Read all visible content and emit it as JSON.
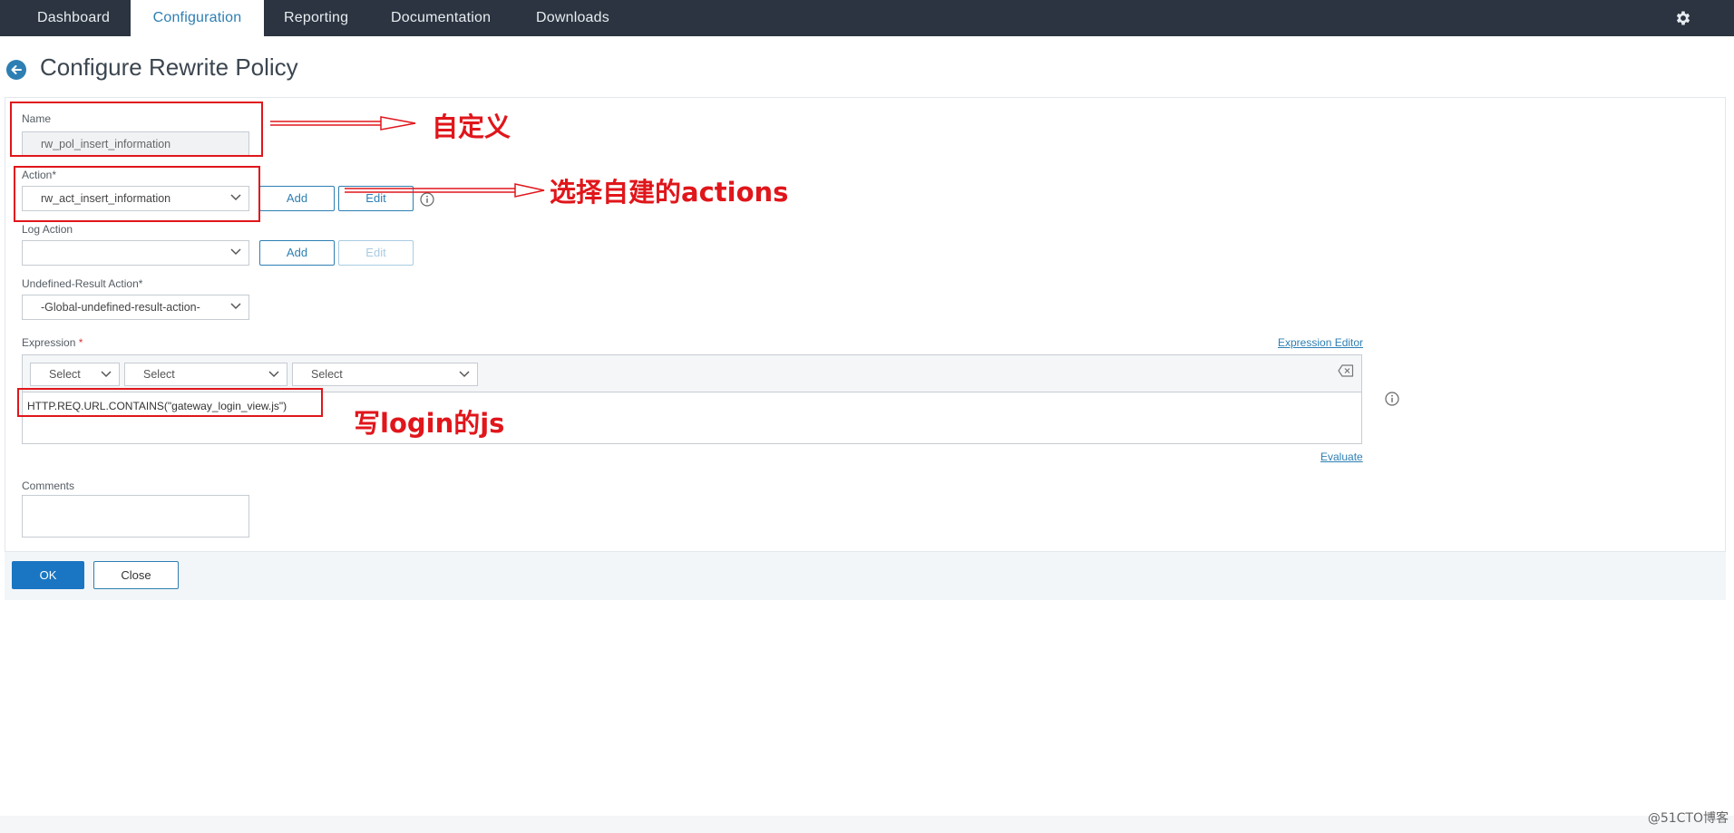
{
  "nav": {
    "tabs": [
      {
        "label": "Dashboard"
      },
      {
        "label": "Configuration"
      },
      {
        "label": "Reporting"
      },
      {
        "label": "Documentation"
      },
      {
        "label": "Downloads"
      }
    ],
    "active_tab": "Configuration",
    "settings_icon": "gear-icon"
  },
  "page": {
    "title": "Configure Rewrite Policy",
    "back_icon": "back-arrow-icon"
  },
  "form": {
    "name_label": "Name",
    "name_value": "rw_pol_insert_information",
    "action_label": "Action*",
    "action_value": "rw_act_insert_information",
    "action_add": "Add",
    "action_edit": "Edit",
    "log_action_label": "Log Action",
    "log_action_value": "",
    "log_add": "Add",
    "log_edit": "Edit",
    "undef_label": "Undefined-Result Action*",
    "undef_value": "-Global-undefined-result-action-",
    "expression_label": "Expression",
    "expression_required": "*",
    "expression_editor_link": "Expression Editor",
    "expression_selects": [
      "Select",
      "Select",
      "Select"
    ],
    "expression_value": "HTTP.REQ.URL.CONTAINS(\"gateway_login_view.js\")",
    "evaluate_link": "Evaluate",
    "comments_label": "Comments",
    "comments_value": ""
  },
  "footer": {
    "ok_label": "OK",
    "close_label": "Close"
  },
  "annotations": {
    "name_note": "自定义",
    "action_note": "选择自建的actions",
    "expression_note": "写login的js",
    "color": "#e0161b"
  },
  "watermark": "@51CTO博客",
  "colors": {
    "nav_bg": "#2b3440",
    "accent": "#2d7fb3",
    "ok_button": "#1a76c2"
  }
}
